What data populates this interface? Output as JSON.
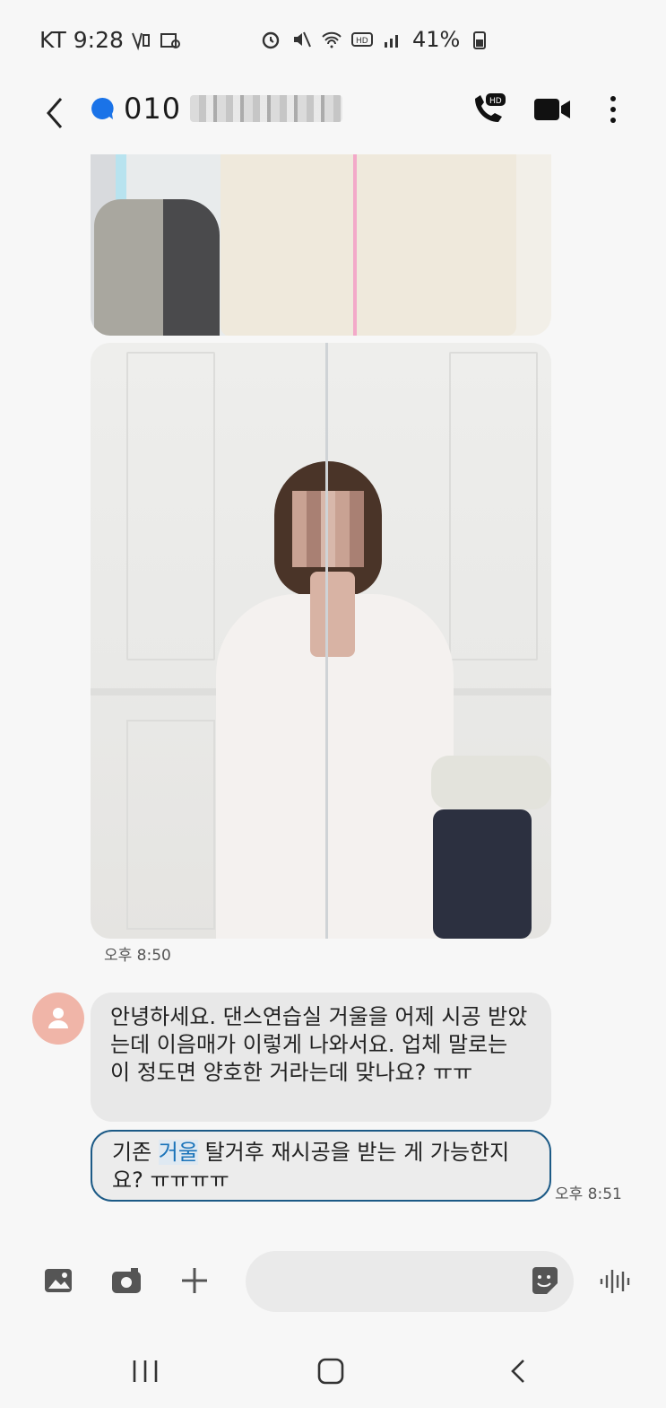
{
  "status_bar": {
    "carrier": "KT",
    "time": "9:28",
    "battery": "41%"
  },
  "header": {
    "contact_number": "010"
  },
  "messages": {
    "image_time": "오후 8:50",
    "incoming_1": "안녕하세요. 댄스연습실 거울을 어제 시공 받았는데 이음매가 이렇게 나와서요. 업체 말로는 이 정도면 양호한 거라는데 맞나요? ㅠㅠ",
    "incoming_2_before": "기존 ",
    "incoming_2_highlight": "거울",
    "incoming_2_after": " 탈거후 재시공을 받는 게 가능한지요? ㅠㅠㅠㅠ",
    "text_time": "오후 8:51"
  },
  "composer": {
    "placeholder": ""
  },
  "colors": {
    "accent_blue": "#1a73e8",
    "bubble_border": "#1c5a86",
    "avatar_bg": "#f0b5a8"
  },
  "icons": {
    "back": "back-arrow-icon",
    "contact_status": "message-dot-icon",
    "hd_call": "hd-call-icon",
    "video_call": "video-call-icon",
    "more": "more-vertical-icon",
    "gallery": "gallery-icon",
    "camera": "camera-icon",
    "add": "plus-icon",
    "sticker": "sticker-icon",
    "voice": "voice-wave-icon"
  }
}
